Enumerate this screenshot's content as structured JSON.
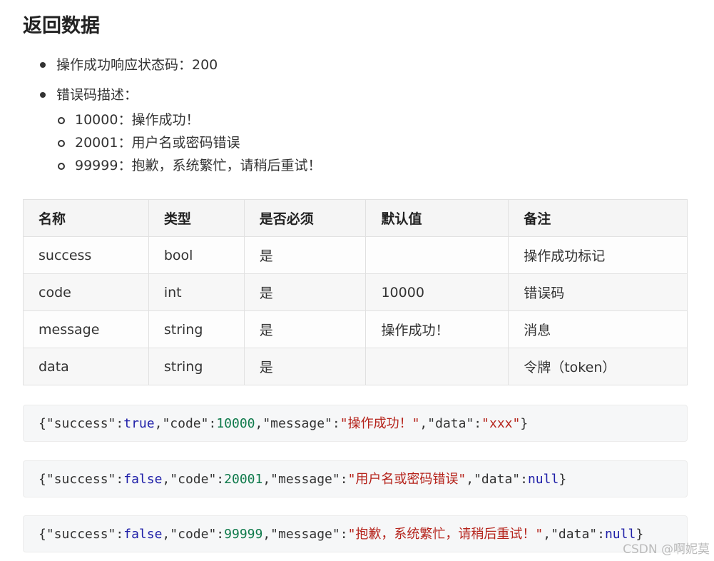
{
  "title": "返回数据",
  "bullets": {
    "status": "操作成功响应状态码：200",
    "error_desc": "错误码描述：",
    "codes": [
      "10000：操作成功！",
      "20001：用户名或密码错误",
      "99999：抱歉，系统繁忙，请稍后重试！"
    ]
  },
  "table": {
    "headers": [
      "名称",
      "类型",
      "是否必须",
      "默认值",
      "备注"
    ],
    "rows": [
      [
        "success",
        "bool",
        "是",
        "",
        "操作成功标记"
      ],
      [
        "code",
        "int",
        "是",
        "10000",
        "错误码"
      ],
      [
        "message",
        "string",
        "是",
        "操作成功！",
        "消息"
      ],
      [
        "data",
        "string",
        "是",
        "",
        "令牌（token）"
      ]
    ]
  },
  "code_blocks": [
    {
      "open": "{",
      "k1": "\"success\"",
      "c1": ":",
      "v1": "true",
      "s1": ",",
      "k2": "\"code\"",
      "c2": ":",
      "v2": "10000",
      "s2": ",",
      "k3": "\"message\"",
      "c3": ":",
      "v3": "\"操作成功！\"",
      "s3": ",",
      "k4": "\"data\"",
      "c4": ":",
      "v4": "\"xxx\"",
      "close": "}"
    },
    {
      "open": "{",
      "k1": "\"success\"",
      "c1": ":",
      "v1": "false",
      "s1": ",",
      "k2": "\"code\"",
      "c2": ":",
      "v2": "20001",
      "s2": ",",
      "k3": "\"message\"",
      "c3": ":",
      "v3": "\"用户名或密码错误\"",
      "s3": ",",
      "k4": "\"data\"",
      "c4": ":",
      "v4": "null",
      "close": "}"
    },
    {
      "open": "{",
      "k1": "\"success\"",
      "c1": ":",
      "v1": "false",
      "s1": ",",
      "k2": "\"code\"",
      "c2": ":",
      "v2": "99999",
      "s2": ",",
      "k3": "\"message\"",
      "c3": ":",
      "v3": "\"抱歉，系统繁忙，请稍后重试！\"",
      "s3": ",",
      "k4": "\"data\"",
      "c4": ":",
      "v4": "null",
      "close": "}"
    }
  ],
  "watermark": "CSDN @啊妮莫",
  "colors": {
    "keyword": "#1f1fa8",
    "number": "#0f7a4b",
    "string": "#b5231b",
    "header_bg": "#f5f5f5"
  }
}
